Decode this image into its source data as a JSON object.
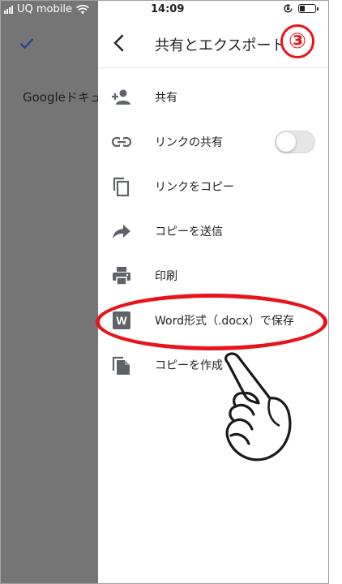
{
  "status_bar": {
    "carrier": "UQ mobile",
    "time": "14:09"
  },
  "background_app": {
    "document_title": "Googleドキュ"
  },
  "drawer": {
    "title": "共有とエクスポート",
    "items": [
      {
        "label": "共有",
        "icon": "person-add-icon"
      },
      {
        "label": "リンクの共有",
        "icon": "link-icon",
        "toggle": false
      },
      {
        "label": "リンクをコピー",
        "icon": "copy-icon"
      },
      {
        "label": "コピーを送信",
        "icon": "forward-icon"
      },
      {
        "label": "印刷",
        "icon": "print-icon"
      },
      {
        "label": "Word形式（.docx）で保存",
        "icon": "word-icon",
        "icon_text": "W"
      },
      {
        "label": "コピーを作成",
        "icon": "file-copy-icon"
      }
    ]
  },
  "annotations": {
    "step_number": "③",
    "highlight_color": "#e8141b"
  },
  "colors": {
    "dim_overlay": "#757575",
    "icon": "#5f6368"
  }
}
